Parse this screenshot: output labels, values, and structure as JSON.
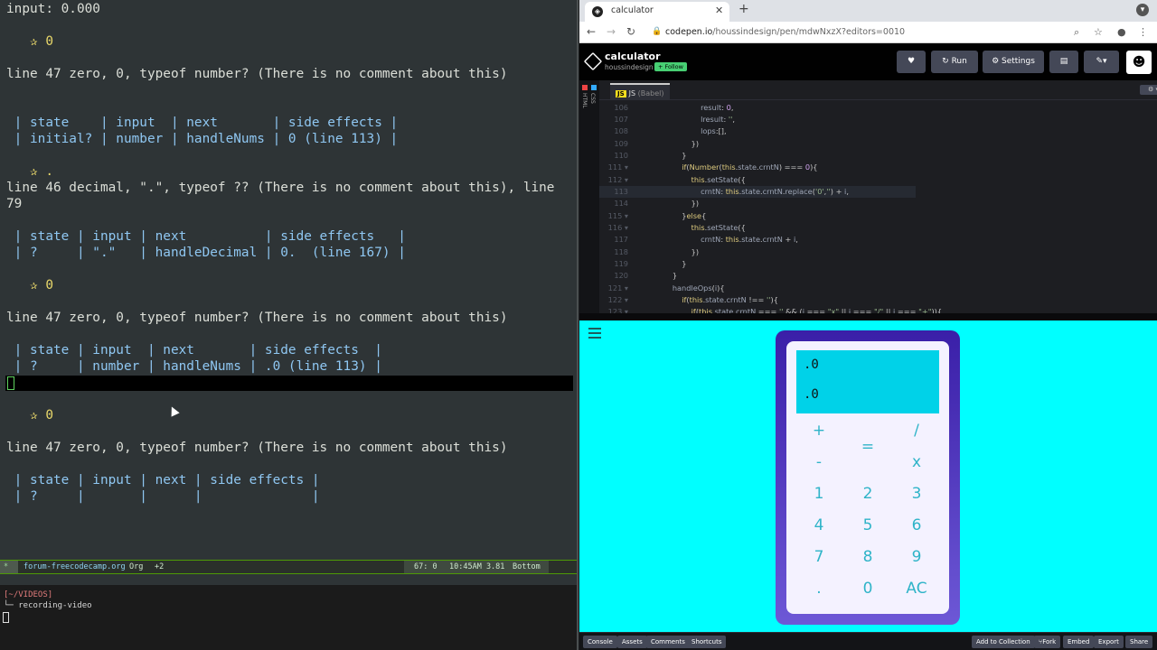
{
  "emacs": {
    "lines": [
      "input: 0.000",
      "   ✰ 0",
      "line 47 zero, 0, typeof number? (There is no comment about this)",
      " | state    | input  | next       | side effects |",
      " | initial? | number | handleNums | 0 (line 113) |",
      "   ✰ .",
      "line 46 decimal, \".\", typeof ?? (There is no comment about this), line",
      "79",
      " | state | input | next          | side effects   |",
      " | ?     | \".\"   | handleDecimal | 0.  (line 167) |",
      "   ✰ 0",
      "line 47 zero, 0, typeof number? (There is no comment about this)",
      " | state | input  | next       | side effects  |",
      " | ?     | number | handleNums | .0 (line 113) |",
      "   ✰ 0",
      "line 47 zero, 0, typeof number? (There is no comment about this)",
      " | state | input | next | side effects |",
      " | ?     |       |      |              |"
    ],
    "modeline": {
      "arrow": "*",
      "buffer": "forum-freecodecamp.org",
      "mode": "Org",
      "extra": "+2",
      "position": "67: 0",
      "time": "10:45AM 3.81",
      "scroll": "Bottom"
    }
  },
  "terminal": {
    "dir": "[~/VIDEOS]",
    "branch": "└─ recording-video"
  },
  "browser": {
    "tab_title": "calculator",
    "url_host": "codepen.io",
    "url_path": "/houssindesign/pen/mdwNxzX?editors=0010",
    "pen": {
      "title": "calculator",
      "author": "houssindesign",
      "follow": "+ Follow",
      "run": "Run",
      "settings": "Settings"
    },
    "editor": {
      "tab": "JS",
      "tab_sub": "(Babel)",
      "side_labels": [
        "HTML",
        "CSS"
      ]
    },
    "calculator": {
      "display_top": ".0",
      "display_bottom": ".0",
      "keys": [
        "+",
        "/",
        "=",
        "-",
        "x",
        "1",
        "2",
        "3",
        "4",
        "5",
        "6",
        "7",
        "8",
        "9",
        ".",
        "0",
        "AC"
      ]
    },
    "footer": {
      "left": [
        "Console",
        "Assets",
        "Comments",
        "Shortcuts"
      ],
      "right": [
        "Add to Collection",
        "Fork",
        "Embed",
        "Export",
        "Share"
      ]
    }
  }
}
